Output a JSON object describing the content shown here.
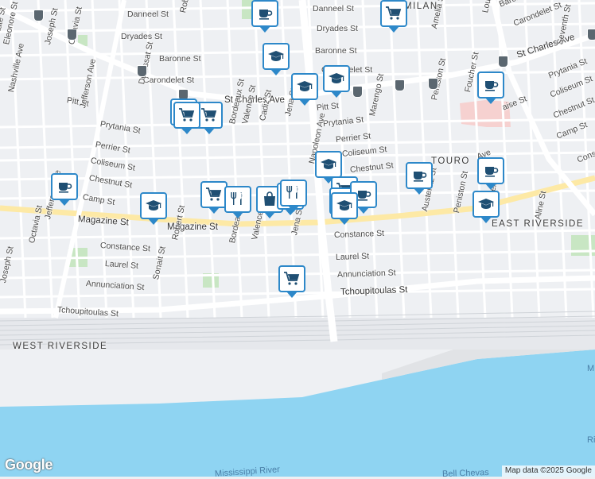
{
  "map": {
    "attribution": "Map data ©2025 Google",
    "logo_text": "Google",
    "neighborhoods": [
      "MILAN",
      "TOURO",
      "EAST RIVERSIDE",
      "WEST RIVERSIDE"
    ],
    "water_labels": [
      "Mississippi River",
      "Bell Chevas"
    ],
    "water_letters": [
      "M",
      "Ri"
    ],
    "streets": {
      "horizontal_top": [
        "Danneel St",
        "Danneel St",
        "Dryades St",
        "Dryades St",
        "Baronne St",
        "Baronne St",
        "Carondelet St",
        "Carondelet St"
      ],
      "st_charles": "St Charles Ave",
      "st_charles_east": "St Charles Ave",
      "mid_left": [
        "Pitt St",
        "Prytania St",
        "Perrier St",
        "Coliseum St",
        "Chestnut St",
        "Camp St"
      ],
      "mid_right": [
        "Pitt St",
        "Prytania St",
        "Perrier St",
        "Coliseum St",
        "Chestnut St"
      ],
      "magazine": "Magazine St",
      "magazine_east": "Magazine St",
      "lower_left": [
        "Constance St",
        "Laurel St",
        "Annunciation St",
        "Tchoupitoulas St"
      ],
      "lower_right": [
        "Constance St",
        "Laurel St",
        "Annunciation St",
        "Tchoupitoulas St"
      ],
      "vertical": [
        "State St",
        "Eleonore St",
        "Nashville Ave",
        "Joseph St",
        "Octavia St",
        "Jefferson Ave",
        "Dufossat St",
        "Robert St",
        "Bordeaux St",
        "Valence St",
        "Cadiz St",
        "Jena St",
        "Napoleon Ave",
        "Marengo St",
        "Amelia St",
        "Peniston St",
        "Foucher St",
        "Louisiana Ave",
        "Austerlitz St",
        "Aline St",
        "Seventh St",
        "Jefferson Ave",
        "Octavia St",
        "Joseph St",
        "Sonait St",
        "Robert St",
        "Bordeaux St",
        "Valence St",
        "Jena St",
        "Peniston St",
        "Amelia St",
        "Ave"
      ],
      "upper_right": [
        "Barone St",
        "Carondelet St",
        "Prytania St",
        "Coliseum St",
        "Chestnut St",
        "Camp St",
        "Constan",
        "aise St",
        "Ave"
      ]
    },
    "colors": {
      "land": "#eef0f3",
      "water": "#8fd4f2",
      "arterial": "#fde9a5",
      "park": "#c8e6c3",
      "hospital": "#f6d1d0",
      "pin_border": "#2d88c9",
      "pin_icon": "#1f4f73"
    },
    "pins": [
      {
        "icon": "cafe-icon"
      },
      {
        "icon": "cafe-icon"
      },
      {
        "icon": "shopping-cart-icon"
      },
      {
        "icon": "school-icon"
      },
      {
        "icon": "school-icon"
      },
      {
        "icon": "school-icon"
      },
      {
        "icon": "cafe-icon"
      },
      {
        "icon": "shopping-cart-icon"
      },
      {
        "icon": "cafe-icon"
      },
      {
        "icon": "shopping-cart-icon"
      },
      {
        "icon": "cafe-icon"
      },
      {
        "icon": "school-icon"
      },
      {
        "icon": "shopping-cart-icon"
      },
      {
        "icon": "restaurant-icon"
      },
      {
        "icon": "shopping-bag-icon"
      },
      {
        "icon": "restaurant-icon"
      },
      {
        "icon": "restaurant-icon"
      },
      {
        "icon": "shopping-cart-icon"
      },
      {
        "icon": "cafe-icon"
      },
      {
        "icon": "school-icon"
      },
      {
        "icon": "cafe-icon"
      },
      {
        "icon": "cafe-icon"
      },
      {
        "icon": "school-icon"
      },
      {
        "icon": "shopping-cart-icon"
      },
      {
        "icon": "school-icon"
      }
    ]
  }
}
